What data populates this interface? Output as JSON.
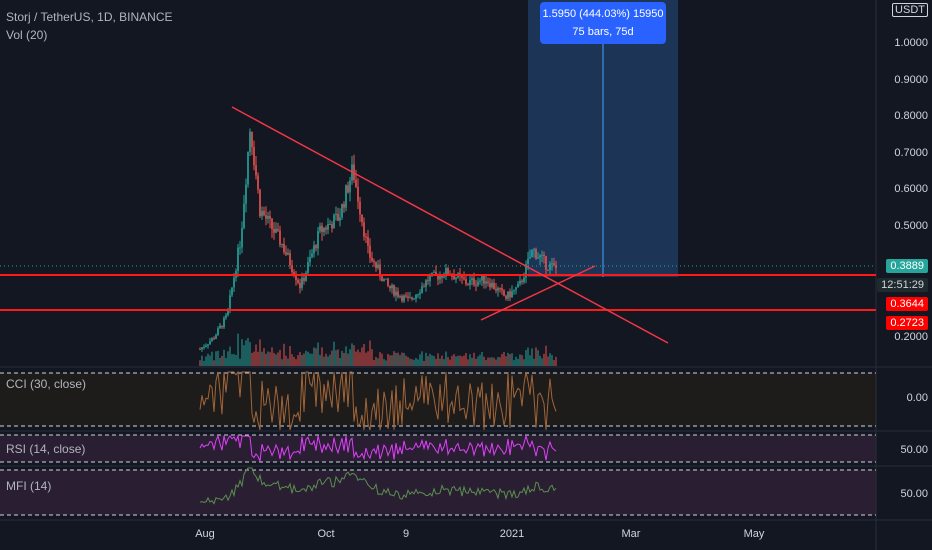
{
  "header": {
    "symbol_line": "Storj / TetherUS, 1D, BINANCE",
    "volume_line": "Vol (20)"
  },
  "currency_badge": "USDT",
  "measure_tooltip": {
    "line1": "1.5950 (444.03%) 15950",
    "line2": "75 bars, 75d"
  },
  "price_axis": {
    "ticks": [
      "1.0000",
      "0.9000",
      "0.8000",
      "0.7000",
      "0.6000",
      "0.5000",
      "0.2000"
    ]
  },
  "price_badges": {
    "last_price": "0.3889",
    "countdown": "12:51:29",
    "level_upper": "0.3644",
    "level_lower": "0.2723"
  },
  "indicators": {
    "cci": {
      "label": "CCI (30, close)",
      "axis_value": "0.00"
    },
    "rsi": {
      "label": "RSI (14, close)",
      "axis_value": "50.00"
    },
    "mfi": {
      "label": "MFI (14)",
      "axis_value": "50.00"
    }
  },
  "time_axis": [
    "Aug",
    "Oct",
    "9",
    "2021",
    "Mar",
    "May"
  ],
  "colors": {
    "background": "#131722",
    "up": "#26a69a",
    "down": "#ef5350",
    "trendline": "#f23645",
    "measure": "#2962ff",
    "cci": "#a0653a",
    "rsi": "#e040fb",
    "mfi": "#5a8f4e",
    "last_price_badge": "#26a69a",
    "level_badge": "#ff0000"
  },
  "chart_data": {
    "type": "candlestick",
    "ylim": [
      0.13,
      1.05
    ],
    "price_points": [
      {
        "date": "2020-07-20",
        "close": 0.17
      },
      {
        "date": "2020-07-27",
        "close": 0.2
      },
      {
        "date": "2020-08-03",
        "close": 0.26
      },
      {
        "date": "2020-08-10",
        "close": 0.47
      },
      {
        "date": "2020-08-15",
        "close": 0.78
      },
      {
        "date": "2020-08-20",
        "close": 0.55
      },
      {
        "date": "2020-08-31",
        "close": 0.46
      },
      {
        "date": "2020-09-10",
        "close": 0.34
      },
      {
        "date": "2020-09-20",
        "close": 0.49
      },
      {
        "date": "2020-09-30",
        "close": 0.53
      },
      {
        "date": "2020-10-07",
        "close": 0.66
      },
      {
        "date": "2020-10-15",
        "close": 0.43
      },
      {
        "date": "2020-10-25",
        "close": 0.34
      },
      {
        "date": "2020-11-05",
        "close": 0.3
      },
      {
        "date": "2020-11-15",
        "close": 0.36
      },
      {
        "date": "2020-11-25",
        "close": 0.38
      },
      {
        "date": "2020-12-05",
        "close": 0.35
      },
      {
        "date": "2020-12-15",
        "close": 0.36
      },
      {
        "date": "2020-12-25",
        "close": 0.31
      },
      {
        "date": "2021-01-01",
        "close": 0.34
      },
      {
        "date": "2021-01-08",
        "close": 0.44
      },
      {
        "date": "2021-01-15",
        "close": 0.4
      },
      {
        "date": "2021-01-20",
        "close": 0.3889
      }
    ],
    "horizontal_levels": [
      0.3644,
      0.2723
    ],
    "last_price": 0.3889,
    "measure": {
      "change": "1.5950",
      "percent": "444.03%",
      "bars": 75,
      "days": 75
    },
    "indicators": [
      "CCI (30, close)",
      "RSI (14, close)",
      "MFI (14)"
    ]
  }
}
